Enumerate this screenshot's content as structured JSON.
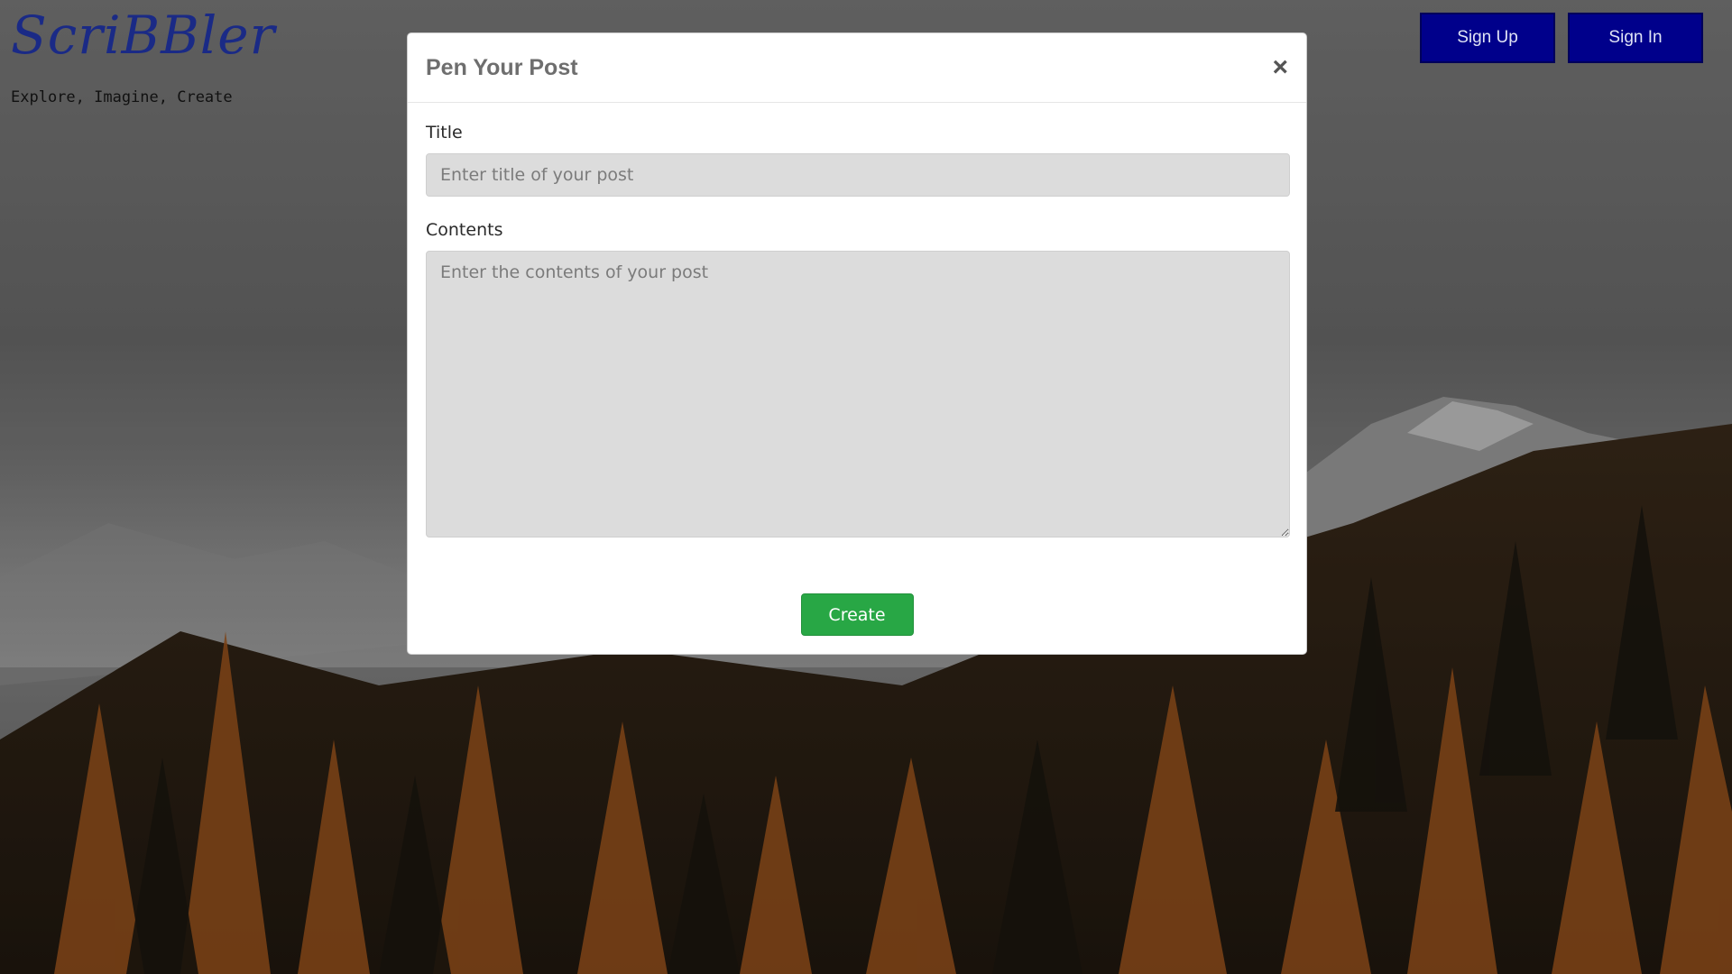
{
  "brand": {
    "logo": "ScriBBler",
    "tagline": "Explore, Imagine, Create"
  },
  "header": {
    "sign_up_label": "Sign Up",
    "sign_in_label": "Sign In"
  },
  "modal": {
    "title": "Pen Your Post",
    "close_glyph": "×",
    "title_label": "Title",
    "title_placeholder": "Enter title of your post",
    "title_value": "",
    "contents_label": "Contents",
    "contents_placeholder": "Enter the contents of your post",
    "contents_value": "",
    "create_label": "Create"
  },
  "colors": {
    "logo": "#1a2a86",
    "auth_button": "#00008b",
    "create_button": "#28a745",
    "input_background": "#dcdcdc"
  },
  "icons": {
    "close": "close-icon"
  }
}
